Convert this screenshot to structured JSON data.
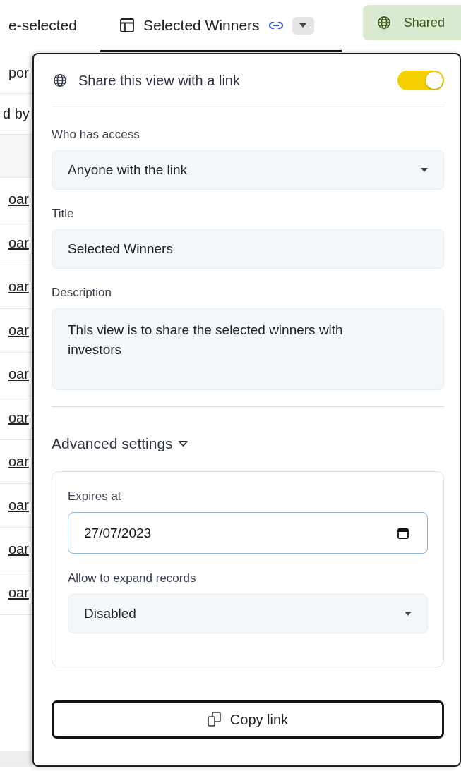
{
  "tabs": [
    {
      "label": "e-selected",
      "selected": false
    },
    {
      "label": "Selected Winners",
      "selected": true,
      "linked": true
    }
  ],
  "shared_button": {
    "label": "Shared"
  },
  "background_table": {
    "rows_above": [
      "por",
      "d by"
    ],
    "rows": [
      "oar",
      "oar",
      "oar",
      "oar",
      "oar",
      "oar",
      "oar",
      "oar",
      "oar",
      "oar"
    ]
  },
  "share_panel": {
    "title": "Share this view with a link",
    "enabled": true,
    "access": {
      "label": "Who has access",
      "value": "Anyone with the link"
    },
    "view_title": {
      "label": "Title",
      "value": "Selected Winners"
    },
    "description": {
      "label": "Description",
      "value": "This view is to share the selected winners with investors"
    },
    "advanced": {
      "label": "Advanced settings",
      "expanded": true,
      "expires": {
        "label": "Expires at",
        "value": "27/07/2023"
      },
      "expand_records": {
        "label": "Allow to expand records",
        "value": "Disabled"
      }
    },
    "copy_button": "Copy link"
  }
}
